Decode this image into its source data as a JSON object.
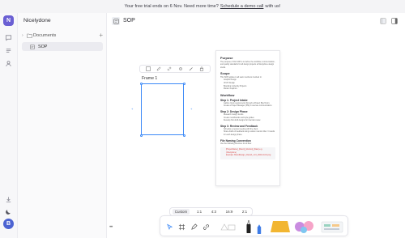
{
  "banner": {
    "prefix": "Your free trial ends on 6 Nov. Need more time?",
    "link": "Schedule a demo call",
    "suffix": "with us!"
  },
  "rail": {
    "workspace_initial": "N",
    "user_initial": "B",
    "brand_color": "#6a5fd3",
    "user_color": "#4c63d2",
    "icons": [
      "chat-icon",
      "list-icon",
      "contacts-icon",
      "download-icon",
      "moon-icon"
    ]
  },
  "sidebar": {
    "workspace_name": "Nicelydone",
    "section_label": "Documents",
    "add_label": "+",
    "items": [
      {
        "label": "SOP"
      }
    ]
  },
  "header": {
    "doc_title": "SOP",
    "icons": [
      "document-icon",
      "hidden-sidebar-icon",
      "panel-icon"
    ]
  },
  "canvas": {
    "frame_label": "Frame 1",
    "selection_color": "#3d8af7",
    "frame_toolbar_icons": [
      "frame-icon",
      "edit-icon",
      "link-icon",
      "settings-icon",
      "pen-icon",
      "lock-icon"
    ]
  },
  "doc_card": {
    "purpose_heading": "Purpose",
    "purpose_text": "The purpose of this SOP is to define the workflow, communication, and quality standards for all design projects at Nicelydone design studio.",
    "scope_heading": "Scope",
    "scope_intro": "This SOP applies to all team members involved in:",
    "scope_items": [
      "Graphic Design",
      "UI/UX Design",
      "Branding & Identity Projects",
      "Motion Graphics"
    ],
    "workflow_heading": "Workflow",
    "step1_heading": "Step 1: Project Intake",
    "step1_items": [
      "Gather client requirements through a Project Brief Form.",
      "Create a Project Manager (PM) to oversee communication."
    ],
    "step2_heading": "Step 2: Design Phase",
    "step2_items": [
      "Research design trends.",
      "Create moodboards and style guides.",
      "Develop first draft designs for internal review."
    ],
    "step3_heading": "Step 3: Review and Feedback",
    "step3_items": [
      "Schedule a review meeting with the client.",
      "Share drafts of feedback using revision rounds. Max: 3 rounds for each design phase."
    ],
    "naming_heading": "File Naming Convention",
    "naming_intro": "Use the following structure for all files:",
    "naming_items": [
      "[ProjectName]_[Client]_[Version]_[Date] e.g. (Nicelydone)",
      "Example: BrandDesign_ClientA_v1.0_2024-10-01.png"
    ]
  },
  "aspect_bar": {
    "options": [
      "Custom",
      "1:1",
      "4:3",
      "16:9",
      "2:1"
    ],
    "selected": "Custom"
  },
  "toolbar": {
    "tools": [
      "select-tool-icon",
      "frame-tool-icon",
      "pen-tool-icon",
      "link-tool-icon",
      "shape-tool-icon",
      "text-tool-icon",
      "marker-tool-icon",
      "sticky-note-icon",
      "sticker-icon",
      "template-icon"
    ]
  }
}
